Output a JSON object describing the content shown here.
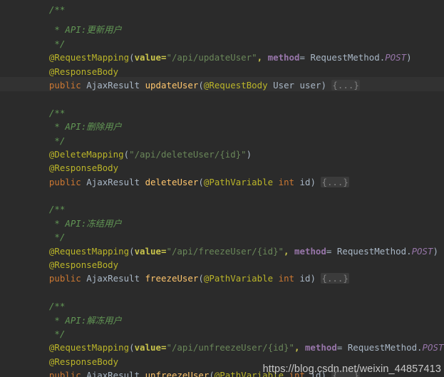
{
  "editor": {
    "background_color": "#2b2b2b",
    "caret_line_color": "#323232",
    "font_size_px": 12.4,
    "line_height_px": 19.4
  },
  "colors": {
    "comment": "#629755",
    "annotation": "#bbb529",
    "attribute_name": "#c9c44b",
    "string": "#6a8759",
    "named_arg": "#9876aa",
    "enum_constant": "#9876aa",
    "keyword": "#cc7832",
    "method_name": "#ffc66d",
    "plain_text": "#a9b7c6",
    "folded_block_bg": "#3b3b3b",
    "folded_block_fg": "#808080"
  },
  "watermark": {
    "text": "https://blog.csdn.net/weixin_44857413"
  },
  "code": {
    "blocks": [
      {
        "name": "update-user",
        "comment_open": "/**",
        "comment_body_prefix": " * ",
        "comment_body": "API:更新用户",
        "comment_close": " */",
        "mapping_annotation": "@RequestMapping",
        "mapping_open": "(",
        "attr_name": "value",
        "attr_eq": "=",
        "path_string": "\"/api/updateUser\"",
        "comma": ", ",
        "method_arg": "method",
        "method_eq": "= ",
        "method_type": "RequestMethod.",
        "method_value": "POST",
        "mapping_close": ")",
        "response_body_annotation": "@ResponseBody",
        "sig_keyword": "public",
        "sig_return_type": "AjaxResult",
        "sig_method_name": "updateUser",
        "sig_paren_open": "(",
        "sig_param_annotation": "@RequestBody",
        "sig_param_type": "User",
        "sig_param_name": "user",
        "sig_paren_close": ")",
        "folded_body": "{...}"
      },
      {
        "name": "delete-user",
        "comment_open": "/**",
        "comment_body_prefix": " * ",
        "comment_body": "API:删除用户",
        "comment_close": " */",
        "mapping_annotation": "@DeleteMapping",
        "mapping_open": "(",
        "path_string": "\"/api/deleteUser/{id}\"",
        "mapping_close": ")",
        "response_body_annotation": "@ResponseBody",
        "sig_keyword": "public",
        "sig_return_type": "AjaxResult",
        "sig_method_name": "deleteUser",
        "sig_paren_open": "(",
        "sig_param_annotation": "@PathVariable",
        "sig_param_type": "int",
        "sig_param_name": "id",
        "sig_paren_close": ")",
        "folded_body": "{...}"
      },
      {
        "name": "freeze-user",
        "comment_open": "/**",
        "comment_body_prefix": " * ",
        "comment_body": "API:冻结用户",
        "comment_close": " */",
        "mapping_annotation": "@RequestMapping",
        "mapping_open": "(",
        "attr_name": "value",
        "attr_eq": "=",
        "path_string": "\"/api/freezeUser/{id}\"",
        "comma": ", ",
        "method_arg": "method",
        "method_eq": "= ",
        "method_type": "RequestMethod.",
        "method_value": "POST",
        "mapping_close": ")",
        "response_body_annotation": "@ResponseBody",
        "sig_keyword": "public",
        "sig_return_type": "AjaxResult",
        "sig_method_name": "freezeUser",
        "sig_paren_open": "(",
        "sig_param_annotation": "@PathVariable",
        "sig_param_type": "int",
        "sig_param_name": "id",
        "sig_paren_close": ")",
        "folded_body": "{...}"
      },
      {
        "name": "unfreeze-user",
        "comment_open": "/**",
        "comment_body_prefix": " * ",
        "comment_body": "API:解冻用户",
        "comment_close": " */",
        "mapping_annotation": "@RequestMapping",
        "mapping_open": "(",
        "attr_name": "value",
        "attr_eq": "=",
        "path_string": "\"/api/unfreezeUser/{id}\"",
        "comma": ", ",
        "method_arg": "method",
        "method_eq": "= ",
        "method_type": "RequestMethod.",
        "method_value": "POST",
        "mapping_close": ")",
        "response_body_annotation": "@ResponseBody",
        "sig_keyword": "public",
        "sig_return_type": "AjaxResult",
        "sig_method_name": "unfreezeUser",
        "sig_paren_open": "(",
        "sig_param_annotation": "@PathVariable",
        "sig_param_type": "int",
        "sig_param_name": "id",
        "sig_paren_close": ")",
        "folded_body": "{...}"
      }
    ]
  }
}
